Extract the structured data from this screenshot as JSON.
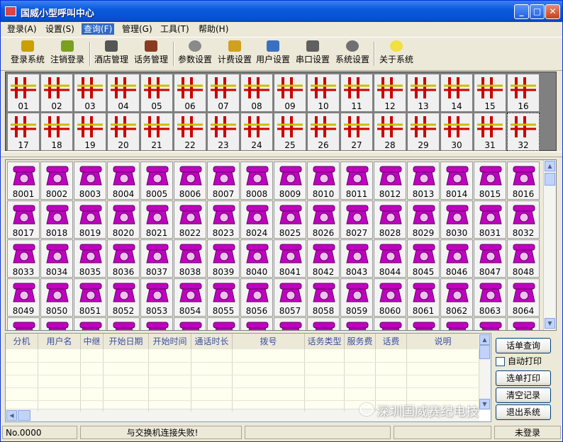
{
  "window": {
    "title": "国威小型呼叫中心"
  },
  "menu": [
    {
      "label": "登录(A)"
    },
    {
      "label": "设置(S)"
    },
    {
      "label": "查询(F)"
    },
    {
      "label": "管理(G)"
    },
    {
      "label": "工具(T)"
    },
    {
      "label": "帮助(H)"
    }
  ],
  "toolbar": [
    {
      "label": "登录系统",
      "icon": "key-user-icon"
    },
    {
      "label": "注销登录",
      "icon": "logout-key-icon"
    },
    {
      "label": "酒店管理",
      "icon": "hotel-phone-icon"
    },
    {
      "label": "话务管理",
      "icon": "call-manage-icon"
    },
    {
      "label": "参数设置",
      "icon": "gear-icon"
    },
    {
      "label": "计费设置",
      "icon": "billing-icon"
    },
    {
      "label": "用户设置",
      "icon": "users-icon"
    },
    {
      "label": "串口设置",
      "icon": "serial-port-icon"
    },
    {
      "label": "系统设置",
      "icon": "system-gear-icon"
    },
    {
      "label": "关于系统",
      "icon": "lightbulb-icon"
    }
  ],
  "trunks": [
    "01",
    "02",
    "03",
    "04",
    "05",
    "06",
    "07",
    "08",
    "09",
    "10",
    "11",
    "12",
    "13",
    "14",
    "15",
    "16",
    "17",
    "18",
    "19",
    "20",
    "21",
    "22",
    "23",
    "24",
    "25",
    "26",
    "27",
    "28",
    "29",
    "30",
    "31",
    "32"
  ],
  "extensions": [
    "8001",
    "8002",
    "8003",
    "8004",
    "8005",
    "8006",
    "8007",
    "8008",
    "8009",
    "8010",
    "8011",
    "8012",
    "8013",
    "8014",
    "8015",
    "8016",
    "8017",
    "8018",
    "8019",
    "8020",
    "8021",
    "8022",
    "8023",
    "8024",
    "8025",
    "8026",
    "8027",
    "8028",
    "8029",
    "8030",
    "8031",
    "8032",
    "8033",
    "8034",
    "8035",
    "8036",
    "8037",
    "8038",
    "8039",
    "8040",
    "8041",
    "8042",
    "8043",
    "8044",
    "8045",
    "8046",
    "8047",
    "8048",
    "8049",
    "8050",
    "8051",
    "8052",
    "8053",
    "8054",
    "8055",
    "8056",
    "8057",
    "8058",
    "8059",
    "8060",
    "8061",
    "8062",
    "8063",
    "8064"
  ],
  "records": {
    "columns": [
      "分机",
      "用户名",
      "中继",
      "开始日期",
      "开始时间",
      "通话时长",
      "拨号",
      "话务类型",
      "服务费",
      "话费",
      "说明"
    ]
  },
  "side": {
    "query_button": "话单查询",
    "auto_print_label": "自动打印",
    "auto_print_checked": false,
    "select_print_button": "选单打印",
    "clear_button": "清空记录",
    "exit_button": "退出系统"
  },
  "status": {
    "number": "No.0000",
    "message": "与交换机连接失败!",
    "login_state": "未登录"
  },
  "watermark": "深圳国威赛纪电技",
  "colors": {
    "phone": "#c000c0",
    "trunk_line": "#cc0000",
    "trunk_bar": "#c8c000",
    "selected_menu": "#316ac5"
  }
}
